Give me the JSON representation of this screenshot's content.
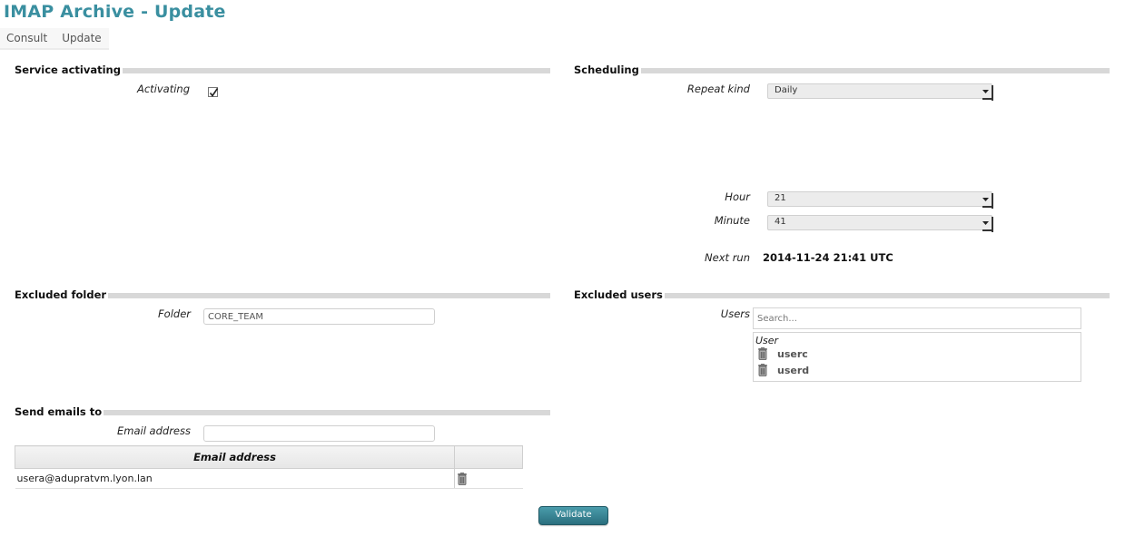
{
  "page": {
    "title": "IMAP Archive - Update"
  },
  "nav": {
    "tabs": [
      "Consult",
      "Update"
    ]
  },
  "service_activating": {
    "header": "Service activating",
    "activating_label": "Activating",
    "activating_checked": true
  },
  "scheduling": {
    "header": "Scheduling",
    "repeat_kind_label": "Repeat kind",
    "repeat_kind_value": "Daily",
    "hour_label": "Hour",
    "hour_value": "21",
    "minute_label": "Minute",
    "minute_value": "41",
    "next_run_label": "Next run",
    "next_run_value": "2014-11-24 21:41 UTC"
  },
  "excluded_folder": {
    "header": "Excluded folder",
    "folder_label": "Folder",
    "folder_value": "CORE_TEAM"
  },
  "excluded_users": {
    "header": "Excluded users",
    "users_label": "Users",
    "search_placeholder": "Search...",
    "list_header": "User",
    "users": [
      "userc",
      "userd"
    ]
  },
  "send_emails": {
    "header": "Send emails to",
    "email_label": "Email address",
    "email_input_value": "",
    "table_header": "Email address",
    "emails": [
      "usera@adupratvm.lyon.lan"
    ]
  },
  "actions": {
    "validate_label": "Validate"
  },
  "colors": {
    "title": "#3a8fa0",
    "button": "#2f7f8f",
    "section_rule": "#d8d8d8"
  },
  "icons": {
    "checkbox_mark": "check-icon",
    "select_arrow": "chevron-down-icon",
    "delete": "trash-icon"
  }
}
